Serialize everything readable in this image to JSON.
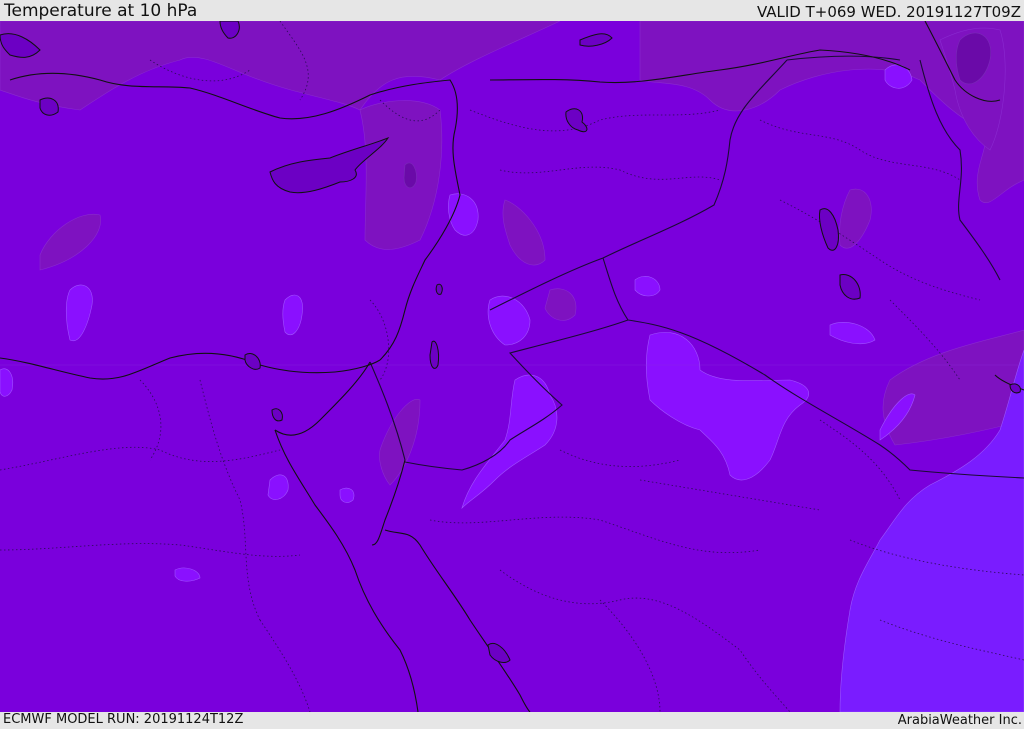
{
  "header": {
    "title": "Temperature at 10 hPa",
    "valid": "VALID T+069 WED. 20191127T09Z"
  },
  "footer": {
    "model_run": "ECMWF MODEL RUN: 20191124T12Z",
    "credit": "ArabiaWeather Inc."
  },
  "colors": {
    "field_base": "#7a00dc",
    "field_warm": "#7e12c0",
    "field_warmer": "#6a0aa8",
    "field_cold": "#8a10ff",
    "field_colder": "#7a1cff",
    "coastline": "#111111",
    "border": "#1a0b33",
    "bar_background": "#e6e6e6"
  }
}
